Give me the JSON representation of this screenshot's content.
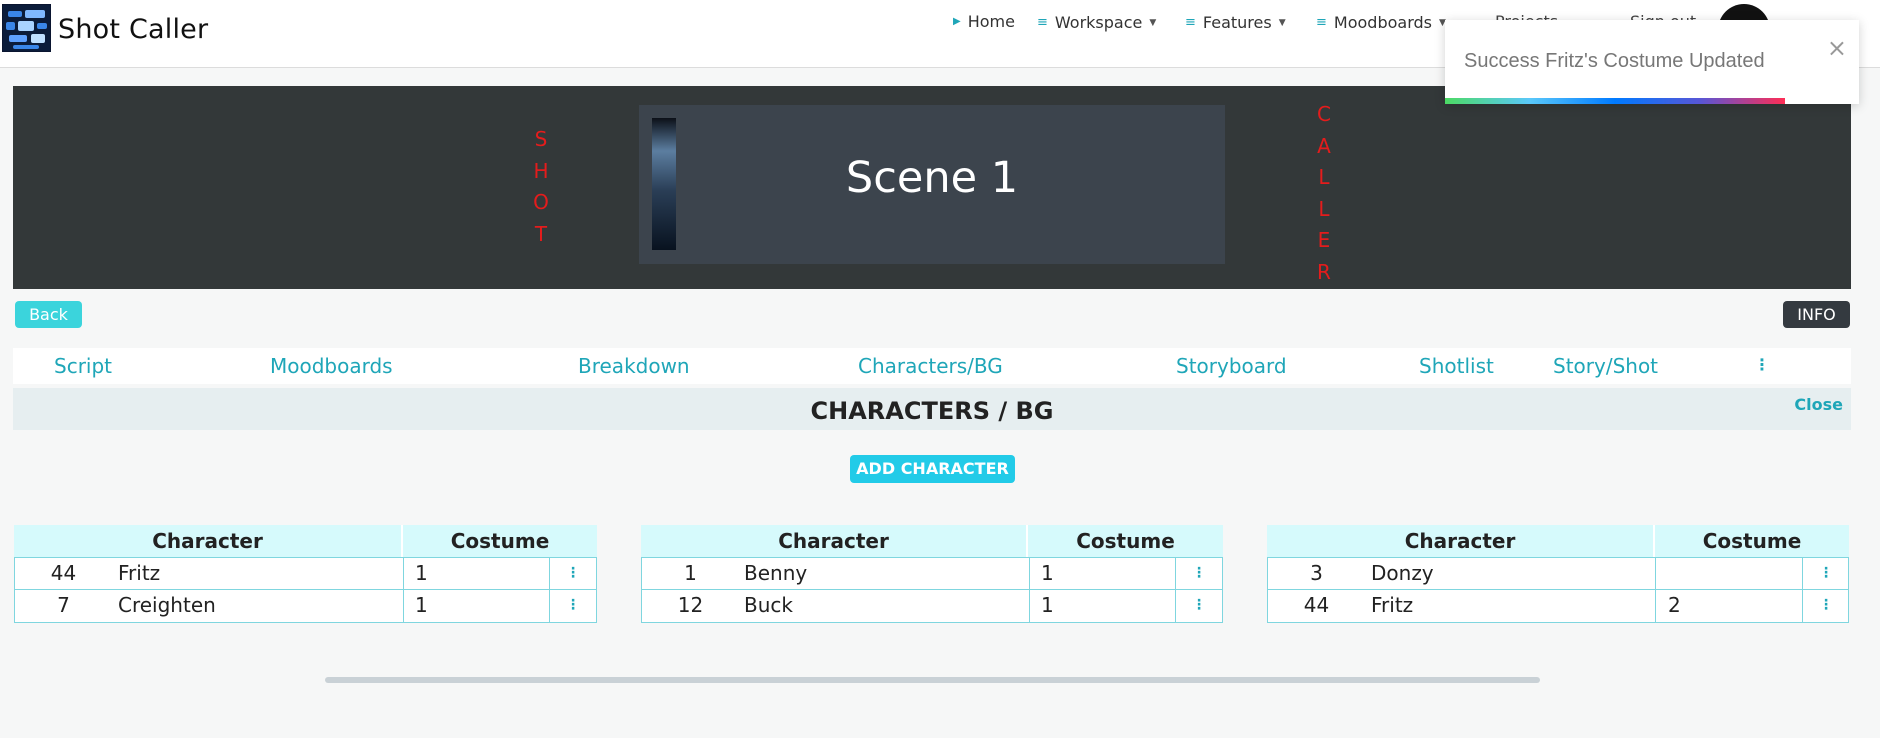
{
  "app": {
    "title": "Shot Caller"
  },
  "nav": {
    "home": "Home",
    "workspace": "Workspace",
    "features": "Features",
    "moodboards": "Moodboards",
    "hidden1": "Projects",
    "hidden2": "Sign out"
  },
  "toast": {
    "message": "Success Fritz's Costume Updated",
    "close": "×"
  },
  "banner": {
    "left_word": [
      "S",
      "H",
      "O",
      "T"
    ],
    "right_word": [
      "C",
      "A",
      "L",
      "L",
      "E",
      "R"
    ],
    "scene_title": "Scene 1"
  },
  "buttons": {
    "back": "Back",
    "info": "INFO",
    "add_character": "ADD CHARACTER"
  },
  "tabs": [
    "Script",
    "Moodboards",
    "Breakdown",
    "Characters/BG",
    "Storyboard",
    "Shotlist",
    "Story/Shot"
  ],
  "tab_more": "⋮",
  "section": {
    "title": "CHARACTERS / BG",
    "close": "Close"
  },
  "tables": [
    {
      "headers": [
        "Character",
        "Costume"
      ],
      "rows": [
        {
          "num": "44",
          "name": "Fritz",
          "costume": "1"
        },
        {
          "num": "7",
          "name": "Creighten",
          "costume": "1"
        }
      ]
    },
    {
      "headers": [
        "Character",
        "Costume"
      ],
      "rows": [
        {
          "num": "1",
          "name": "Benny",
          "costume": "1"
        },
        {
          "num": "12",
          "name": "Buck",
          "costume": "1"
        }
      ]
    },
    {
      "headers": [
        "Character",
        "Costume"
      ],
      "rows": [
        {
          "num": "3",
          "name": "Donzy",
          "costume": ""
        },
        {
          "num": "44",
          "name": "Fritz",
          "costume": "2"
        }
      ]
    }
  ],
  "row_menu": "⋮",
  "colors": {
    "accent": "#1fa6b8",
    "button": "#3bd4dc",
    "banner": "#333839",
    "brand_red": "#e41c1c"
  }
}
